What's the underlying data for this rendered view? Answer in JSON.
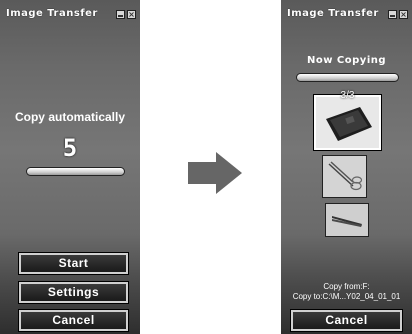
{
  "left_window": {
    "title": "Image Transfer",
    "mode_label": "Copy automatically",
    "countdown": "5",
    "buttons": {
      "start": "Start",
      "settings": "Settings",
      "cancel": "Cancel"
    },
    "title_icons": [
      "minimize-icon",
      "close-icon"
    ]
  },
  "right_window": {
    "title": "Image Transfer",
    "status_label": "Now Copying",
    "counter": "3/3",
    "copy_from": "Copy from:F:",
    "copy_to": "Copy to:C:\\M...Y02_04_01_01",
    "buttons": {
      "cancel": "Cancel"
    },
    "thumbnails": [
      "camera-photo",
      "scissors-photo",
      "tweezers-photo"
    ]
  },
  "transition": {
    "icon": "right-arrow-icon"
  },
  "colors": {
    "panel_dark": "#2e2e2e",
    "panel_mid": "#767676",
    "text": "#ffffff",
    "arrow": "#666666"
  }
}
